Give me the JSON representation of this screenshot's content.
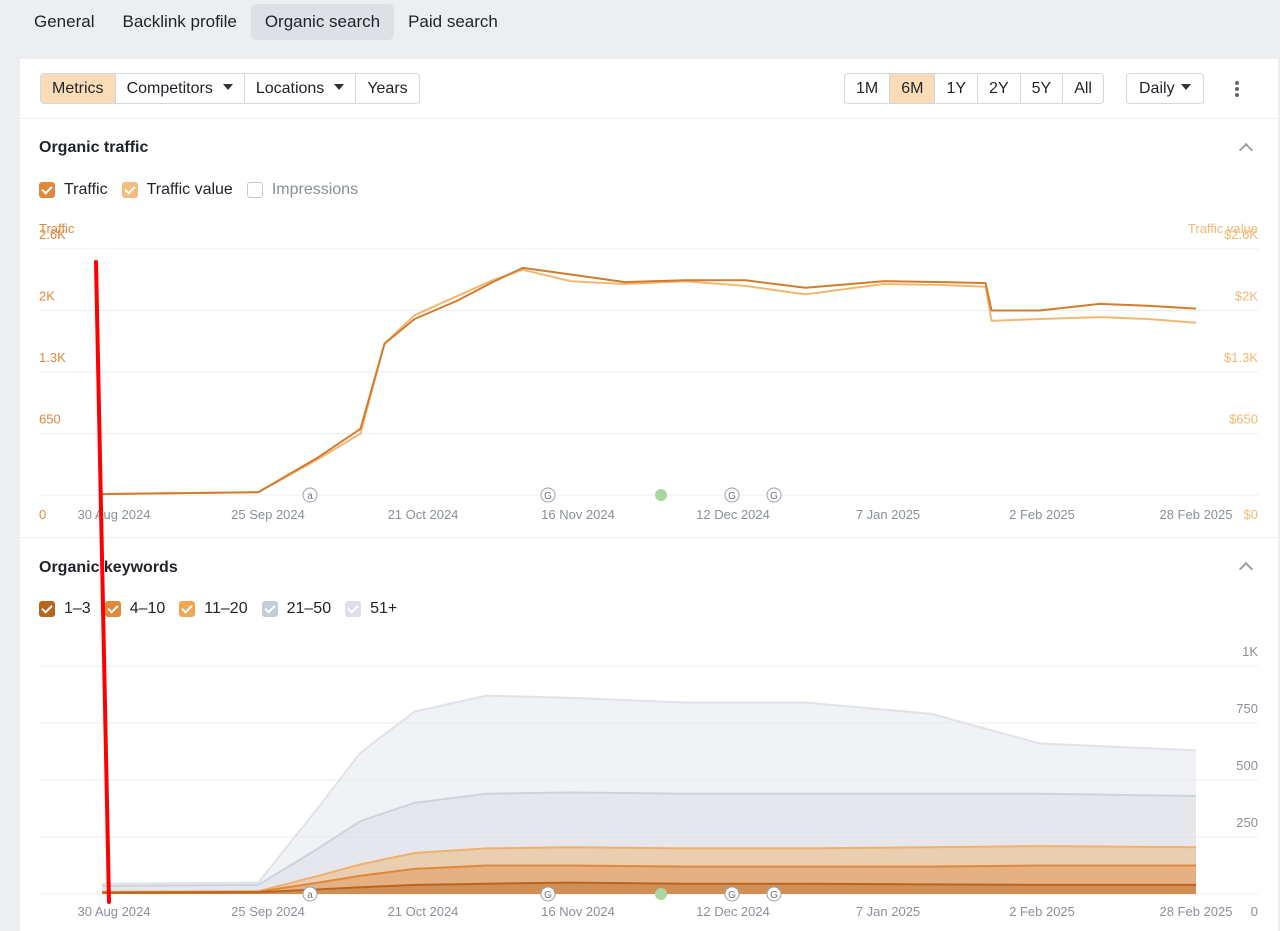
{
  "top_tabs": [
    "General",
    "Backlink profile",
    "Organic search",
    "Paid search"
  ],
  "toolbar": {
    "left": [
      "Metrics",
      "Competitors",
      "Locations",
      "Years"
    ],
    "ranges": [
      "1M",
      "6M",
      "1Y",
      "2Y",
      "5Y",
      "All"
    ],
    "active_range": "6M",
    "granularity": "Daily"
  },
  "colors": {
    "traffic": "#d27d2d",
    "traffic_value": "#f2b872",
    "pos_1_3": "#b8661f",
    "pos_4_10": "#e0883a",
    "pos_11_20": "#f0b06c",
    "pos_21_50": "#cdd3dc",
    "pos_51_plus": "#dfe3e9",
    "annotation": "#ff0000"
  },
  "sections": {
    "traffic": {
      "title": "Organic traffic",
      "legend": [
        "Traffic",
        "Traffic value",
        "Impressions"
      ],
      "left_axis_title": "Traffic",
      "right_axis_title": "Traffic value"
    },
    "keywords": {
      "title": "Organic keywords",
      "legend": [
        "1–3",
        "4–10",
        "11–20",
        "21–50",
        "51+"
      ]
    }
  },
  "chart_data": [
    {
      "type": "line",
      "title": "Organic traffic",
      "x_ticks": [
        "30 Aug 2024",
        "25 Sep 2024",
        "21 Oct 2024",
        "16 Nov 2024",
        "12 Dec 2024",
        "7 Jan 2025",
        "2 Feb 2025",
        "28 Feb 2025"
      ],
      "y_left_ticks": [
        "0",
        "650",
        "1.3K",
        "2K",
        "2.6K"
      ],
      "y_right_ticks": [
        "$0",
        "$650",
        "$1.3K",
        "$2K",
        "$2.6K"
      ],
      "ylim": [
        0,
        2600
      ],
      "x": [
        "2024-08-30",
        "2024-09-25",
        "2024-10-05",
        "2024-10-12",
        "2024-10-16",
        "2024-10-21",
        "2024-10-28",
        "2024-11-03",
        "2024-11-08",
        "2024-11-16",
        "2024-11-25",
        "2024-12-05",
        "2024-12-15",
        "2024-12-25",
        "2025-01-07",
        "2025-01-17",
        "2025-01-24",
        "2025-01-25",
        "2025-02-02",
        "2025-02-12",
        "2025-02-20",
        "2025-02-28"
      ],
      "series": [
        {
          "name": "Traffic",
          "values": [
            10,
            30,
            400,
            700,
            1600,
            1860,
            2050,
            2250,
            2400,
            2330,
            2250,
            2270,
            2270,
            2190,
            2260,
            2250,
            2240,
            1950,
            1950,
            2020,
            2000,
            1970
          ]
        },
        {
          "name": "Traffic value",
          "values": [
            10,
            30,
            380,
            650,
            1600,
            1900,
            2100,
            2270,
            2380,
            2260,
            2230,
            2260,
            2210,
            2120,
            2230,
            2220,
            2200,
            1840,
            1860,
            1880,
            1860,
            1820
          ]
        }
      ],
      "markers": [
        "a",
        "G",
        "G",
        "G"
      ]
    },
    {
      "type": "area",
      "title": "Organic keywords",
      "stacked": false,
      "x_ticks": [
        "30 Aug 2024",
        "25 Sep 2024",
        "21 Oct 2024",
        "16 Nov 2024",
        "12 Dec 2024",
        "7 Jan 2025",
        "2 Feb 2025",
        "28 Feb 2025"
      ],
      "y_ticks": [
        "0",
        "250",
        "500",
        "750",
        "1K"
      ],
      "ylim": [
        0,
        1000
      ],
      "x": [
        "2024-08-30",
        "2024-09-25",
        "2024-10-05",
        "2024-10-12",
        "2024-10-21",
        "2024-11-02",
        "2024-11-16",
        "2024-12-05",
        "2024-12-25",
        "2025-01-15",
        "2025-02-02",
        "2025-02-28"
      ],
      "series": [
        {
          "name": "1–3",
          "values": [
            5,
            8,
            20,
            30,
            40,
            45,
            50,
            45,
            45,
            42,
            40,
            40
          ]
        },
        {
          "name": "4–10",
          "values": [
            8,
            10,
            50,
            80,
            110,
            125,
            125,
            120,
            120,
            120,
            125,
            125
          ]
        },
        {
          "name": "11–20",
          "values": [
            10,
            12,
            80,
            130,
            180,
            200,
            205,
            200,
            200,
            205,
            210,
            205
          ]
        },
        {
          "name": "21–50",
          "values": [
            35,
            40,
            200,
            320,
            400,
            440,
            445,
            440,
            440,
            440,
            440,
            430
          ]
        },
        {
          "name": "51+",
          "values": [
            45,
            50,
            380,
            620,
            800,
            870,
            860,
            840,
            840,
            790,
            660,
            630
          ]
        }
      ],
      "markers": [
        "a",
        "G",
        "G",
        "G"
      ]
    }
  ]
}
